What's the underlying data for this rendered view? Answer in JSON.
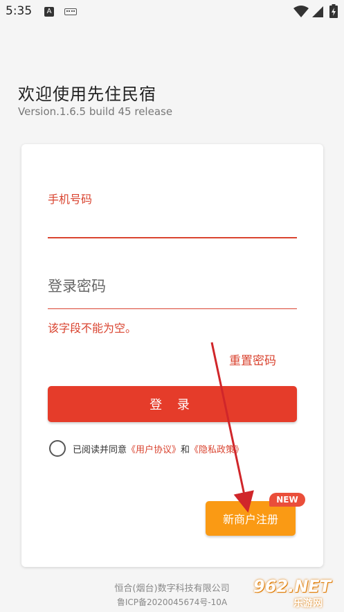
{
  "status_bar": {
    "time": "5:35",
    "icons": [
      "a-notification-icon",
      "keyboard-icon",
      "wifi-icon",
      "signal-icon",
      "battery-icon"
    ]
  },
  "header": {
    "title": "欢迎使用先住民宿",
    "version": "Version.1.6.5 build 45 release"
  },
  "form": {
    "phone_label": "手机号码",
    "phone_value": "",
    "password_placeholder": "登录密码",
    "error_message": "该字段不能为空。",
    "reset_password": "重置密码",
    "login_label": "登 录",
    "agreement": {
      "prefix": "已阅读并同意",
      "user_agreement": "《用户协议》",
      "and": "和",
      "privacy_policy": "《隐私政策》",
      "checked": false
    },
    "register_label": "新商户注册",
    "new_badge": "NEW"
  },
  "footer": {
    "company": "恒合(烟台)数字科技有限公司",
    "icp": "鲁ICP备2020045674号-10A"
  },
  "watermark": {
    "main": "962.NET",
    "sub": "乐游网"
  },
  "colors": {
    "accent": "#e53c2a",
    "register": "#fa9a14",
    "background": "#f5f5f5"
  }
}
